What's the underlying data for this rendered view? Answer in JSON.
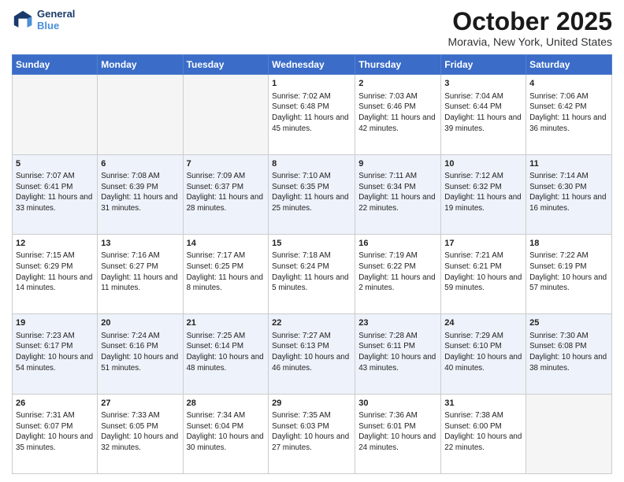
{
  "header": {
    "logo_line1": "General",
    "logo_line2": "Blue",
    "month_title": "October 2025",
    "location": "Moravia, New York, United States"
  },
  "days_of_week": [
    "Sunday",
    "Monday",
    "Tuesday",
    "Wednesday",
    "Thursday",
    "Friday",
    "Saturday"
  ],
  "weeks": [
    [
      {
        "day": "",
        "info": ""
      },
      {
        "day": "",
        "info": ""
      },
      {
        "day": "",
        "info": ""
      },
      {
        "day": "1",
        "info": "Sunrise: 7:02 AM\nSunset: 6:48 PM\nDaylight: 11 hours and 45 minutes."
      },
      {
        "day": "2",
        "info": "Sunrise: 7:03 AM\nSunset: 6:46 PM\nDaylight: 11 hours and 42 minutes."
      },
      {
        "day": "3",
        "info": "Sunrise: 7:04 AM\nSunset: 6:44 PM\nDaylight: 11 hours and 39 minutes."
      },
      {
        "day": "4",
        "info": "Sunrise: 7:06 AM\nSunset: 6:42 PM\nDaylight: 11 hours and 36 minutes."
      }
    ],
    [
      {
        "day": "5",
        "info": "Sunrise: 7:07 AM\nSunset: 6:41 PM\nDaylight: 11 hours and 33 minutes."
      },
      {
        "day": "6",
        "info": "Sunrise: 7:08 AM\nSunset: 6:39 PM\nDaylight: 11 hours and 31 minutes."
      },
      {
        "day": "7",
        "info": "Sunrise: 7:09 AM\nSunset: 6:37 PM\nDaylight: 11 hours and 28 minutes."
      },
      {
        "day": "8",
        "info": "Sunrise: 7:10 AM\nSunset: 6:35 PM\nDaylight: 11 hours and 25 minutes."
      },
      {
        "day": "9",
        "info": "Sunrise: 7:11 AM\nSunset: 6:34 PM\nDaylight: 11 hours and 22 minutes."
      },
      {
        "day": "10",
        "info": "Sunrise: 7:12 AM\nSunset: 6:32 PM\nDaylight: 11 hours and 19 minutes."
      },
      {
        "day": "11",
        "info": "Sunrise: 7:14 AM\nSunset: 6:30 PM\nDaylight: 11 hours and 16 minutes."
      }
    ],
    [
      {
        "day": "12",
        "info": "Sunrise: 7:15 AM\nSunset: 6:29 PM\nDaylight: 11 hours and 14 minutes."
      },
      {
        "day": "13",
        "info": "Sunrise: 7:16 AM\nSunset: 6:27 PM\nDaylight: 11 hours and 11 minutes."
      },
      {
        "day": "14",
        "info": "Sunrise: 7:17 AM\nSunset: 6:25 PM\nDaylight: 11 hours and 8 minutes."
      },
      {
        "day": "15",
        "info": "Sunrise: 7:18 AM\nSunset: 6:24 PM\nDaylight: 11 hours and 5 minutes."
      },
      {
        "day": "16",
        "info": "Sunrise: 7:19 AM\nSunset: 6:22 PM\nDaylight: 11 hours and 2 minutes."
      },
      {
        "day": "17",
        "info": "Sunrise: 7:21 AM\nSunset: 6:21 PM\nDaylight: 10 hours and 59 minutes."
      },
      {
        "day": "18",
        "info": "Sunrise: 7:22 AM\nSunset: 6:19 PM\nDaylight: 10 hours and 57 minutes."
      }
    ],
    [
      {
        "day": "19",
        "info": "Sunrise: 7:23 AM\nSunset: 6:17 PM\nDaylight: 10 hours and 54 minutes."
      },
      {
        "day": "20",
        "info": "Sunrise: 7:24 AM\nSunset: 6:16 PM\nDaylight: 10 hours and 51 minutes."
      },
      {
        "day": "21",
        "info": "Sunrise: 7:25 AM\nSunset: 6:14 PM\nDaylight: 10 hours and 48 minutes."
      },
      {
        "day": "22",
        "info": "Sunrise: 7:27 AM\nSunset: 6:13 PM\nDaylight: 10 hours and 46 minutes."
      },
      {
        "day": "23",
        "info": "Sunrise: 7:28 AM\nSunset: 6:11 PM\nDaylight: 10 hours and 43 minutes."
      },
      {
        "day": "24",
        "info": "Sunrise: 7:29 AM\nSunset: 6:10 PM\nDaylight: 10 hours and 40 minutes."
      },
      {
        "day": "25",
        "info": "Sunrise: 7:30 AM\nSunset: 6:08 PM\nDaylight: 10 hours and 38 minutes."
      }
    ],
    [
      {
        "day": "26",
        "info": "Sunrise: 7:31 AM\nSunset: 6:07 PM\nDaylight: 10 hours and 35 minutes."
      },
      {
        "day": "27",
        "info": "Sunrise: 7:33 AM\nSunset: 6:05 PM\nDaylight: 10 hours and 32 minutes."
      },
      {
        "day": "28",
        "info": "Sunrise: 7:34 AM\nSunset: 6:04 PM\nDaylight: 10 hours and 30 minutes."
      },
      {
        "day": "29",
        "info": "Sunrise: 7:35 AM\nSunset: 6:03 PM\nDaylight: 10 hours and 27 minutes."
      },
      {
        "day": "30",
        "info": "Sunrise: 7:36 AM\nSunset: 6:01 PM\nDaylight: 10 hours and 24 minutes."
      },
      {
        "day": "31",
        "info": "Sunrise: 7:38 AM\nSunset: 6:00 PM\nDaylight: 10 hours and 22 minutes."
      },
      {
        "day": "",
        "info": ""
      }
    ]
  ]
}
